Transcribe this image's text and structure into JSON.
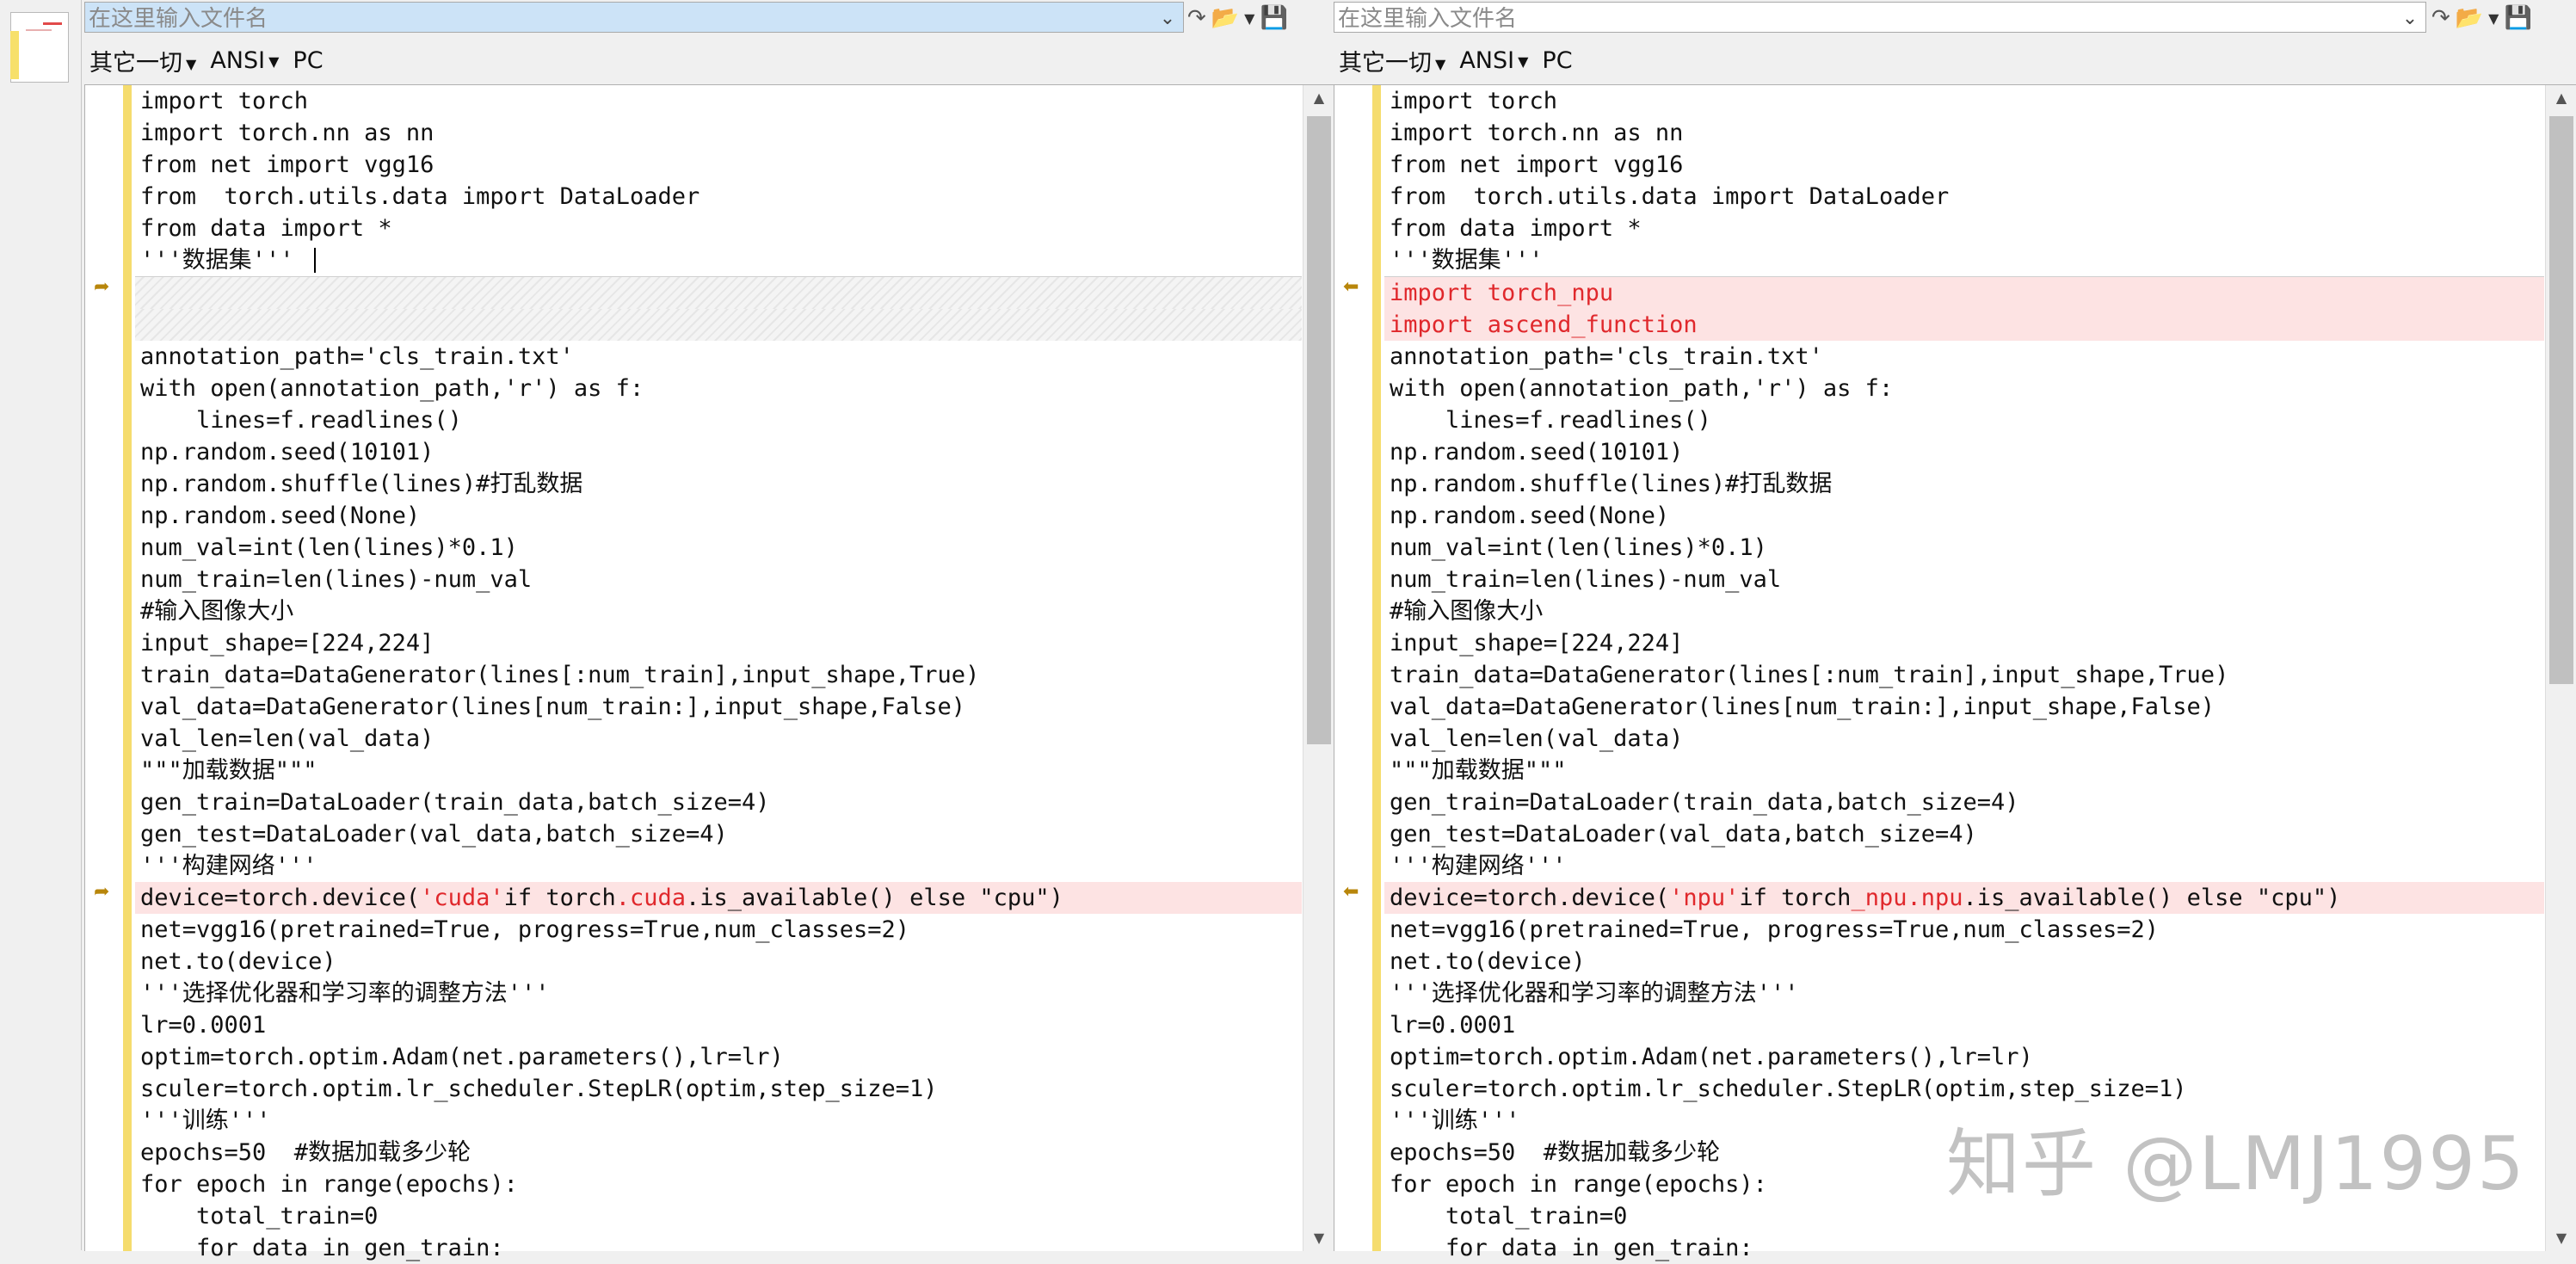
{
  "filename_placeholder": "在这里输入文件名",
  "options": [
    "其它一切",
    "ANSI",
    "PC"
  ],
  "left_lines": [
    "import torch",
    "import torch.nn as nn",
    "from net import vgg16",
    "from  torch.utils.data import DataLoader",
    "from data import *",
    "'''数据集'''",
    "",
    "",
    "annotation_path='cls_train.txt'",
    "with open(annotation_path,'r') as f:",
    "    lines=f.readlines()",
    "np.random.seed(10101)",
    "np.random.shuffle(lines)#打乱数据",
    "np.random.seed(None)",
    "num_val=int(len(lines)*0.1)",
    "num_train=len(lines)-num_val",
    "#输入图像大小",
    "input_shape=[224,224]",
    "train_data=DataGenerator(lines[:num_train],input_shape,True)",
    "val_data=DataGenerator(lines[num_train:],input_shape,False)",
    "val_len=len(val_data)",
    "\"\"\"加载数据\"\"\"",
    "gen_train=DataLoader(train_data,batch_size=4)",
    "gen_test=DataLoader(val_data,batch_size=4)",
    "'''构建网络'''",
    "device=torch.device('cuda'if torch.cuda.is_available() else \"cpu\")",
    "net=vgg16(pretrained=True, progress=True,num_classes=2)",
    "net.to(device)",
    "'''选择优化器和学习率的调整方法'''",
    "lr=0.0001",
    "optim=torch.optim.Adam(net.parameters(),lr=lr)",
    "sculer=torch.optim.lr_scheduler.StepLR(optim,step_size=1)",
    "'''训练'''",
    "epochs=50  #数据加载多少轮",
    "for epoch in range(epochs):",
    "    total_train=0",
    "    for data in gen_train:"
  ],
  "right_lines": [
    "import torch",
    "import torch.nn as nn",
    "from net import vgg16",
    "from  torch.utils.data import DataLoader",
    "from data import *",
    "'''数据集'''",
    "import torch_npu",
    "import ascend_function",
    "annotation_path='cls_train.txt'",
    "with open(annotation_path,'r') as f:",
    "    lines=f.readlines()",
    "np.random.seed(10101)",
    "np.random.shuffle(lines)#打乱数据",
    "np.random.seed(None)",
    "num_val=int(len(lines)*0.1)",
    "num_train=len(lines)-num_val",
    "#输入图像大小",
    "input_shape=[224,224]",
    "train_data=DataGenerator(lines[:num_train],input_shape,True)",
    "val_data=DataGenerator(lines[num_train:],input_shape,False)",
    "val_len=len(val_data)",
    "\"\"\"加载数据\"\"\"",
    "gen_train=DataLoader(train_data,batch_size=4)",
    "gen_test=DataLoader(val_data,batch_size=4)",
    "'''构建网络'''",
    "device=torch.device('npu'if torch_npu.npu.is_available() else \"cpu\")",
    "net=vgg16(pretrained=True, progress=True,num_classes=2)",
    "net.to(device)",
    "'''选择优化器和学习率的调整方法'''",
    "lr=0.0001",
    "optim=torch.optim.Adam(net.parameters(),lr=lr)",
    "sculer=torch.optim.lr_scheduler.StepLR(optim,step_size=1)",
    "'''训练'''",
    "epochs=50  #数据加载多少轮",
    "for epoch in range(epochs):",
    "    total_train=0",
    "    for data in gen_train:"
  ],
  "left_device_parts": [
    "device=torch.device(",
    "'cuda'",
    "if torch",
    ".cuda",
    ".is_available() else \"cpu\")"
  ],
  "right_device_parts": [
    "device=torch.device(",
    "'npu'",
    "if torch",
    "_npu.npu",
    ".is_available() else \"cpu\")"
  ],
  "watermark": "知乎 @LMJ1995",
  "colors": {
    "changed_bg": "#fde3e3",
    "changed_text": "#e0282c",
    "gutter": "#f5dc6e",
    "arrow": "#b8860b"
  }
}
